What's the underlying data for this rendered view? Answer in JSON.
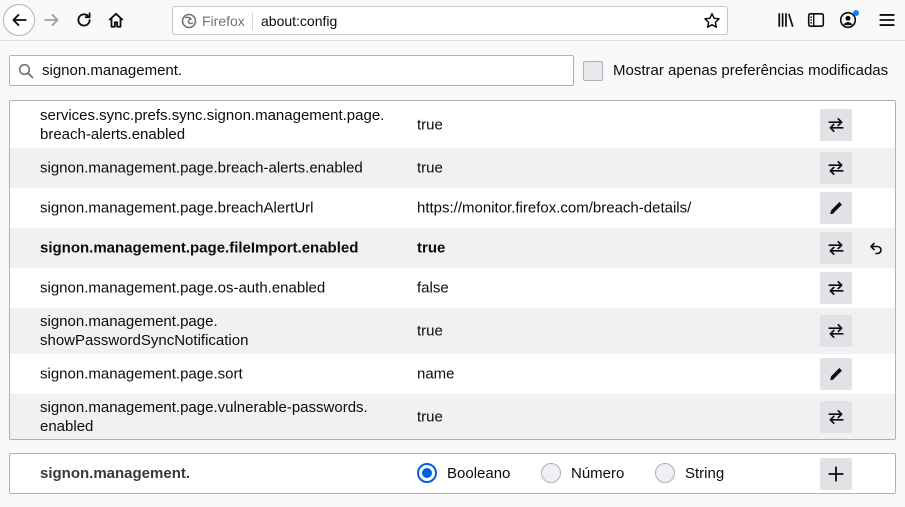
{
  "browser": {
    "identity_label": "Firefox",
    "url": "about:config"
  },
  "search": {
    "value": "signon.management.",
    "modified_only_label": "Mostrar apenas preferências modificadas"
  },
  "prefs": [
    {
      "name": "services.sync.prefs.sync.signon.management.page.\nbreach-alerts.enabled",
      "value": "true",
      "action": "toggle",
      "modified": false
    },
    {
      "name": "signon.management.page.breach-alerts.enabled",
      "value": "true",
      "action": "toggle",
      "modified": false
    },
    {
      "name": "signon.management.page.breachAlertUrl",
      "value": "https://monitor.firefox.com/breach-details/",
      "action": "edit",
      "modified": false
    },
    {
      "name": "signon.management.page.fileImport.enabled",
      "value": "true",
      "action": "toggle",
      "modified": true
    },
    {
      "name": "signon.management.page.os-auth.enabled",
      "value": "false",
      "action": "toggle",
      "modified": false
    },
    {
      "name": "signon.management.page.\nshowPasswordSyncNotification",
      "value": "true",
      "action": "toggle",
      "modified": false
    },
    {
      "name": "signon.management.page.sort",
      "value": "name",
      "action": "edit",
      "modified": false
    },
    {
      "name": "signon.management.page.vulnerable-passwords.\nenabled",
      "value": "true",
      "action": "toggle",
      "modified": false
    }
  ],
  "add_pref": {
    "name": "signon.management.",
    "types": [
      {
        "label": "Booleano",
        "selected": true
      },
      {
        "label": "Número",
        "selected": false
      },
      {
        "label": "String",
        "selected": false
      }
    ]
  },
  "icons": {
    "back": "back-arrow-icon",
    "forward": "forward-arrow-icon",
    "reload": "reload-icon",
    "home": "home-icon",
    "firefox": "firefox-logo-icon",
    "star": "star-icon",
    "library": "library-icon",
    "sidebar": "sidebar-icon",
    "account": "account-icon",
    "menu": "hamburger-menu-icon",
    "search": "search-icon",
    "toggle": "toggle-arrows-icon",
    "edit": "pencil-icon",
    "reset": "reset-undo-icon",
    "add": "plus-icon"
  },
  "colors": {
    "accent": "#0060df",
    "notification_dot": "#0a84ff"
  }
}
